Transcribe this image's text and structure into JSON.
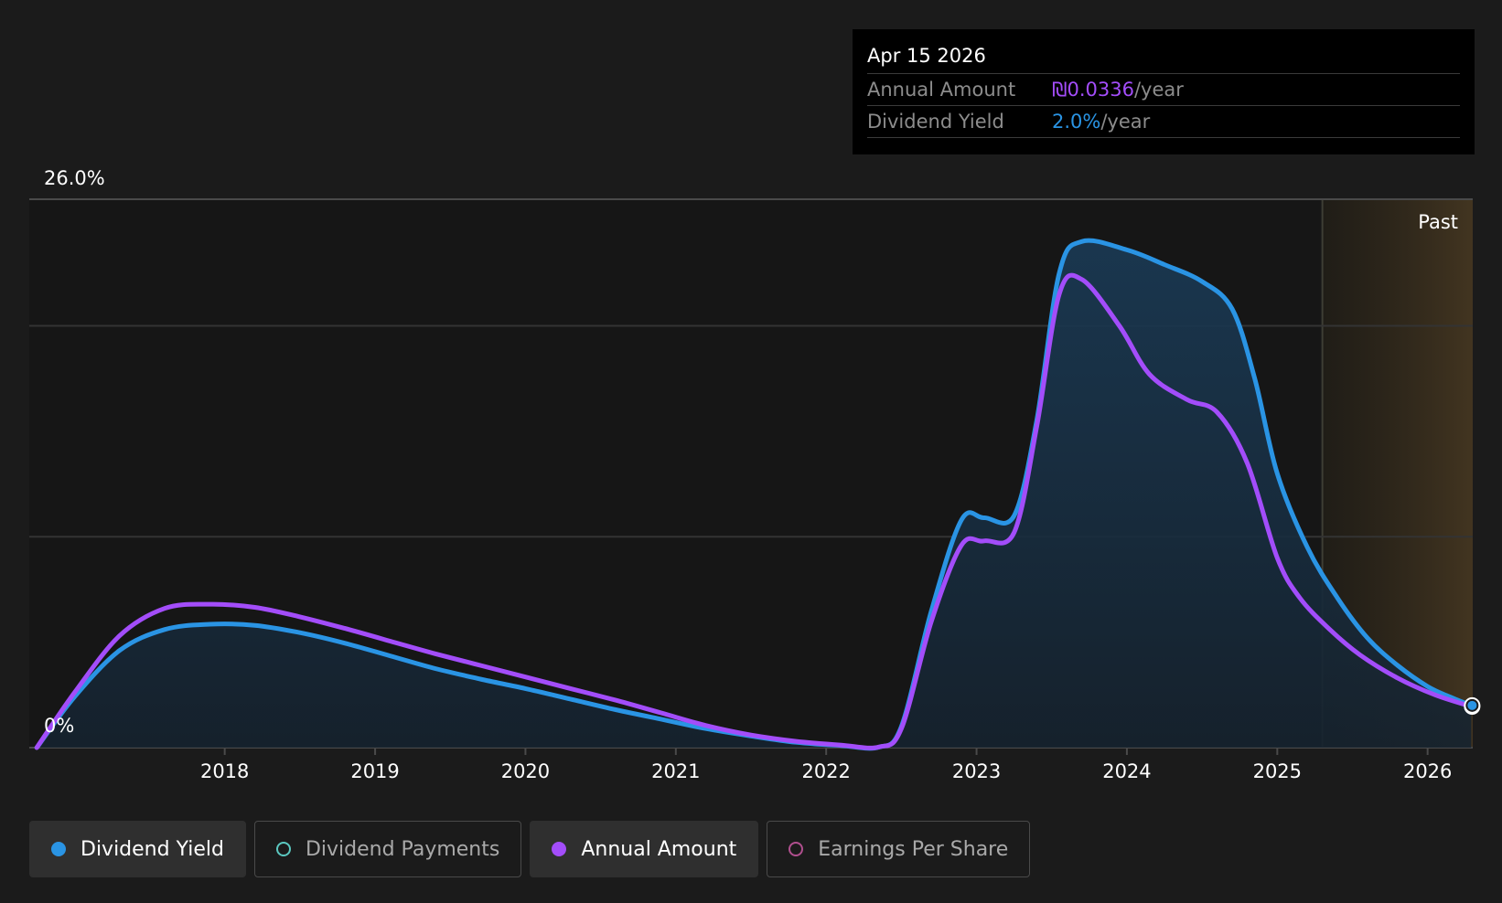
{
  "tooltip": {
    "date": "Apr 15 2026",
    "rows": [
      {
        "label": "Annual Amount",
        "value": "₪0.0336",
        "suffix": "/year",
        "color": "#a34dfa"
      },
      {
        "label": "Dividend Yield",
        "value": "2.0%",
        "suffix": "/year",
        "color": "#2a94e4"
      }
    ]
  },
  "legend": [
    {
      "label": "Dividend Yield",
      "color": "#2a94e4",
      "active": true,
      "filled": true
    },
    {
      "label": "Dividend Payments",
      "color": "#5bc8c0",
      "active": false,
      "filled": false
    },
    {
      "label": "Annual Amount",
      "color": "#a34dfa",
      "active": true,
      "filled": true
    },
    {
      "label": "Earnings Per Share",
      "color": "#b04f8e",
      "active": false,
      "filled": false
    }
  ],
  "chart_data": {
    "type": "line",
    "y_top_label": "26.0%",
    "y_bottom_label": "0%",
    "ylim": [
      0,
      26
    ],
    "xlim": [
      2016.7,
      2026.3
    ],
    "past_label": "Past",
    "past_start": 2025.3,
    "x_ticks": [
      {
        "label": "2018",
        "value": 2018
      },
      {
        "label": "2019",
        "value": 2019
      },
      {
        "label": "2020",
        "value": 2020
      },
      {
        "label": "2021",
        "value": 2021
      },
      {
        "label": "2022",
        "value": 2022
      },
      {
        "label": "2023",
        "value": 2023
      },
      {
        "label": "2024",
        "value": 2024
      },
      {
        "label": "2025",
        "value": 2025
      },
      {
        "label": "2026",
        "value": 2026
      }
    ],
    "gridlines": [
      10,
      20
    ],
    "series": [
      {
        "name": "Dividend Yield",
        "color": "#2a94e4",
        "points": [
          [
            2016.75,
            0
          ],
          [
            2017.0,
            2.4
          ],
          [
            2017.3,
            4.6
          ],
          [
            2017.6,
            5.6
          ],
          [
            2017.9,
            5.85
          ],
          [
            2018.2,
            5.8
          ],
          [
            2018.5,
            5.45
          ],
          [
            2018.8,
            4.95
          ],
          [
            2019.1,
            4.35
          ],
          [
            2019.4,
            3.75
          ],
          [
            2019.7,
            3.25
          ],
          [
            2020.0,
            2.8
          ],
          [
            2020.3,
            2.3
          ],
          [
            2020.6,
            1.8
          ],
          [
            2020.9,
            1.35
          ],
          [
            2021.2,
            0.9
          ],
          [
            2021.5,
            0.55
          ],
          [
            2021.8,
            0.25
          ],
          [
            2022.1,
            0.1
          ],
          [
            2022.35,
            0.02
          ],
          [
            2022.5,
            1.0
          ],
          [
            2022.7,
            6.5
          ],
          [
            2022.9,
            10.8
          ],
          [
            2023.05,
            10.9
          ],
          [
            2023.25,
            11.0
          ],
          [
            2023.4,
            15.5
          ],
          [
            2023.55,
            22.5
          ],
          [
            2023.7,
            24.0
          ],
          [
            2024.0,
            23.6
          ],
          [
            2024.25,
            22.9
          ],
          [
            2024.5,
            22.1
          ],
          [
            2024.7,
            20.8
          ],
          [
            2024.85,
            17.5
          ],
          [
            2025.0,
            13.0
          ],
          [
            2025.2,
            9.5
          ],
          [
            2025.4,
            7.1
          ],
          [
            2025.6,
            5.2
          ],
          [
            2025.8,
            3.9
          ],
          [
            2026.0,
            2.9
          ],
          [
            2026.15,
            2.4
          ],
          [
            2026.29,
            2.0
          ]
        ]
      },
      {
        "name": "Annual Amount",
        "color": "#a34dfa",
        "points": [
          [
            2016.75,
            0
          ],
          [
            2017.0,
            2.6
          ],
          [
            2017.3,
            5.3
          ],
          [
            2017.6,
            6.6
          ],
          [
            2017.9,
            6.8
          ],
          [
            2018.2,
            6.65
          ],
          [
            2018.5,
            6.2
          ],
          [
            2018.8,
            5.65
          ],
          [
            2019.1,
            5.05
          ],
          [
            2019.4,
            4.45
          ],
          [
            2019.7,
            3.9
          ],
          [
            2020.0,
            3.35
          ],
          [
            2020.3,
            2.8
          ],
          [
            2020.6,
            2.25
          ],
          [
            2020.9,
            1.65
          ],
          [
            2021.2,
            1.05
          ],
          [
            2021.5,
            0.6
          ],
          [
            2021.8,
            0.3
          ],
          [
            2022.1,
            0.12
          ],
          [
            2022.35,
            0.03
          ],
          [
            2022.5,
            0.9
          ],
          [
            2022.7,
            6.0
          ],
          [
            2022.9,
            9.6
          ],
          [
            2023.05,
            9.8
          ],
          [
            2023.25,
            10.2
          ],
          [
            2023.4,
            15.2
          ],
          [
            2023.55,
            21.5
          ],
          [
            2023.7,
            22.2
          ],
          [
            2023.95,
            20.0
          ],
          [
            2024.15,
            17.7
          ],
          [
            2024.4,
            16.5
          ],
          [
            2024.6,
            15.9
          ],
          [
            2024.8,
            13.5
          ],
          [
            2025.0,
            9.0
          ],
          [
            2025.15,
            7.1
          ],
          [
            2025.35,
            5.6
          ],
          [
            2025.55,
            4.4
          ],
          [
            2025.8,
            3.3
          ],
          [
            2026.05,
            2.5
          ],
          [
            2026.29,
            1.95
          ]
        ]
      }
    ]
  }
}
